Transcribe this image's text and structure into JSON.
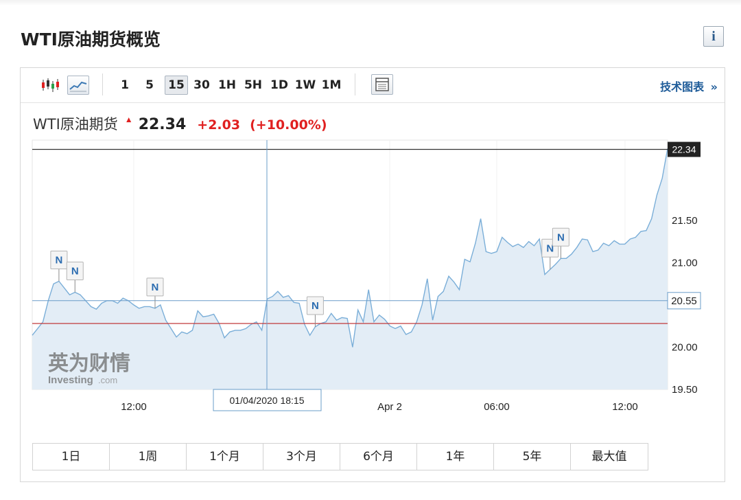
{
  "page": {
    "title": "WTI原油期货概览",
    "info_icon": "info-icon",
    "info_label": "i"
  },
  "toolbar": {
    "chart_type_icons": [
      "candlestick-icon",
      "line-chart-icon"
    ],
    "timeframes": [
      "1",
      "5",
      "15",
      "30",
      "1H",
      "5H",
      "1D",
      "1W",
      "1M"
    ],
    "active_timeframe": "15",
    "table_icon": "table-icon",
    "tech_chart_label": "技术图表",
    "tech_chart_arrow": "»"
  },
  "quote": {
    "name": "WTI原油期货",
    "arrow": "▲",
    "price": "22.34",
    "change": "+2.03",
    "change_pct": "(+10.00%)"
  },
  "colors": {
    "up": "#e02020",
    "line": "#7aaed8",
    "area": "#e3edf6",
    "crosshair": "#6a9cc9",
    "accent": "#1f5c99"
  },
  "chart_data": {
    "type": "area",
    "x_ticks": [
      "12:00",
      "Apr 2",
      "06:00",
      "12:00"
    ],
    "y_ticks": [
      "21.50",
      "21.00",
      "20.55",
      "20.00",
      "19.50"
    ],
    "ylim": [
      19.5,
      22.45
    ],
    "current_price_label": "22.34",
    "crosshair_value_label": "20.55",
    "crosshair_time_label": "01/04/2020 18:15",
    "reference_line": 20.28,
    "prices": [
      20.14,
      20.22,
      20.3,
      20.55,
      20.75,
      20.78,
      20.7,
      20.62,
      20.65,
      20.62,
      20.55,
      20.48,
      20.45,
      20.52,
      20.55,
      20.55,
      20.52,
      20.58,
      20.55,
      20.5,
      20.46,
      20.48,
      20.48,
      20.46,
      20.5,
      20.32,
      20.22,
      20.12,
      20.18,
      20.16,
      20.2,
      20.43,
      20.36,
      20.37,
      20.39,
      20.28,
      20.11,
      20.18,
      20.2,
      20.2,
      20.22,
      20.27,
      20.3,
      20.2,
      20.57,
      20.6,
      20.66,
      20.59,
      20.61,
      20.53,
      20.52,
      20.27,
      20.14,
      20.24,
      20.28,
      20.3,
      20.4,
      20.32,
      20.35,
      20.34,
      20.0,
      20.44,
      20.3,
      20.68,
      20.3,
      20.38,
      20.33,
      20.25,
      20.22,
      20.25,
      20.15,
      20.18,
      20.3,
      20.5,
      20.81,
      20.32,
      20.6,
      20.66,
      20.84,
      20.77,
      20.68,
      21.04,
      21.01,
      21.23,
      21.52,
      21.13,
      21.11,
      21.13,
      21.3,
      21.24,
      21.19,
      21.22,
      21.18,
      21.25,
      21.2,
      21.28,
      20.86,
      20.92,
      20.98,
      21.05,
      21.05,
      21.1,
      21.18,
      21.28,
      21.27,
      21.13,
      21.15,
      21.23,
      21.2,
      21.26,
      21.22,
      21.22,
      21.28,
      21.3,
      21.37,
      21.38,
      21.52,
      21.8,
      22.0,
      22.35
    ],
    "news_markers": [
      {
        "label": "N",
        "x_index": 5
      },
      {
        "label": "N",
        "x_index": 8
      },
      {
        "label": "N",
        "x_index": 23
      },
      {
        "label": "N",
        "x_index": 53
      },
      {
        "label": "N",
        "x_index": 97
      },
      {
        "label": "N",
        "x_index": 99
      }
    ],
    "watermark": {
      "logo_text": "英为财情",
      "sub_text": "Investing",
      "sub_suffix": ".com"
    }
  },
  "range_buttons": [
    "1日",
    "1周",
    "1个月",
    "3个月",
    "6个月",
    "1年",
    "5年",
    "最大值"
  ]
}
